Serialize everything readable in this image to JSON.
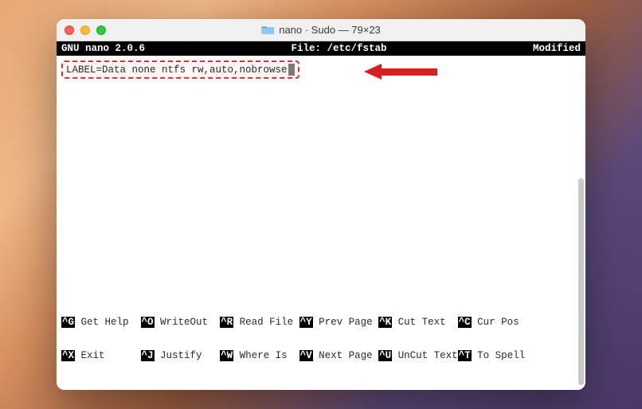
{
  "window": {
    "title": "nano · Sudo — 79×23"
  },
  "header": {
    "app": "GNU nano 2.0.6",
    "file_label": "File: /etc/fstab",
    "status": "Modified"
  },
  "editor": {
    "line1": "LABEL=Data none ntfs rw,auto,nobrowse"
  },
  "footer": {
    "r1c1_key": "^G",
    "r1c1_label": " Get Help  ",
    "r1c2_key": "^O",
    "r1c2_label": " WriteOut  ",
    "r1c3_key": "^R",
    "r1c3_label": " Read File ",
    "r1c4_key": "^Y",
    "r1c4_label": " Prev Page ",
    "r1c5_key": "^K",
    "r1c5_label": " Cut Text  ",
    "r1c6_key": "^C",
    "r1c6_label": " Cur Pos",
    "r2c1_key": "^X",
    "r2c1_label": " Exit      ",
    "r2c2_key": "^J",
    "r2c2_label": " Justify   ",
    "r2c3_key": "^W",
    "r2c3_label": " Where Is  ",
    "r2c4_key": "^V",
    "r2c4_label": " Next Page ",
    "r2c5_key": "^U",
    "r2c5_label": " UnCut Text",
    "r2c6_key": "^T",
    "r2c6_label": " To Spell"
  }
}
